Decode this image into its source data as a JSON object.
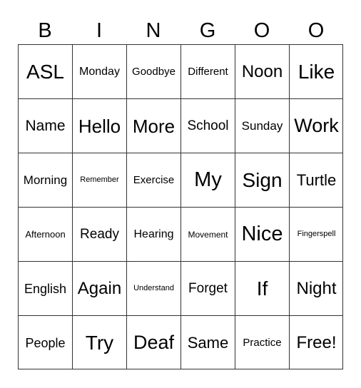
{
  "header": [
    "B",
    "I",
    "N",
    "G",
    "O",
    "O"
  ],
  "rows": [
    [
      "ASL",
      "Monday",
      "Goodbye",
      "Different",
      "Noon",
      "Like"
    ],
    [
      "Name",
      "Hello",
      "More",
      "School",
      "Sunday",
      "Work"
    ],
    [
      "Morning",
      "Remember",
      "Exercise",
      "My",
      "Sign",
      "Turtle"
    ],
    [
      "Afternoon",
      "Ready",
      "Hearing",
      "Movement",
      "Nice",
      "Fingerspell"
    ],
    [
      "English",
      "Again",
      "Understand",
      "Forget",
      "If",
      "Night"
    ],
    [
      "People",
      "Try",
      "Deaf",
      "Same",
      "Practice",
      "Free!"
    ]
  ]
}
